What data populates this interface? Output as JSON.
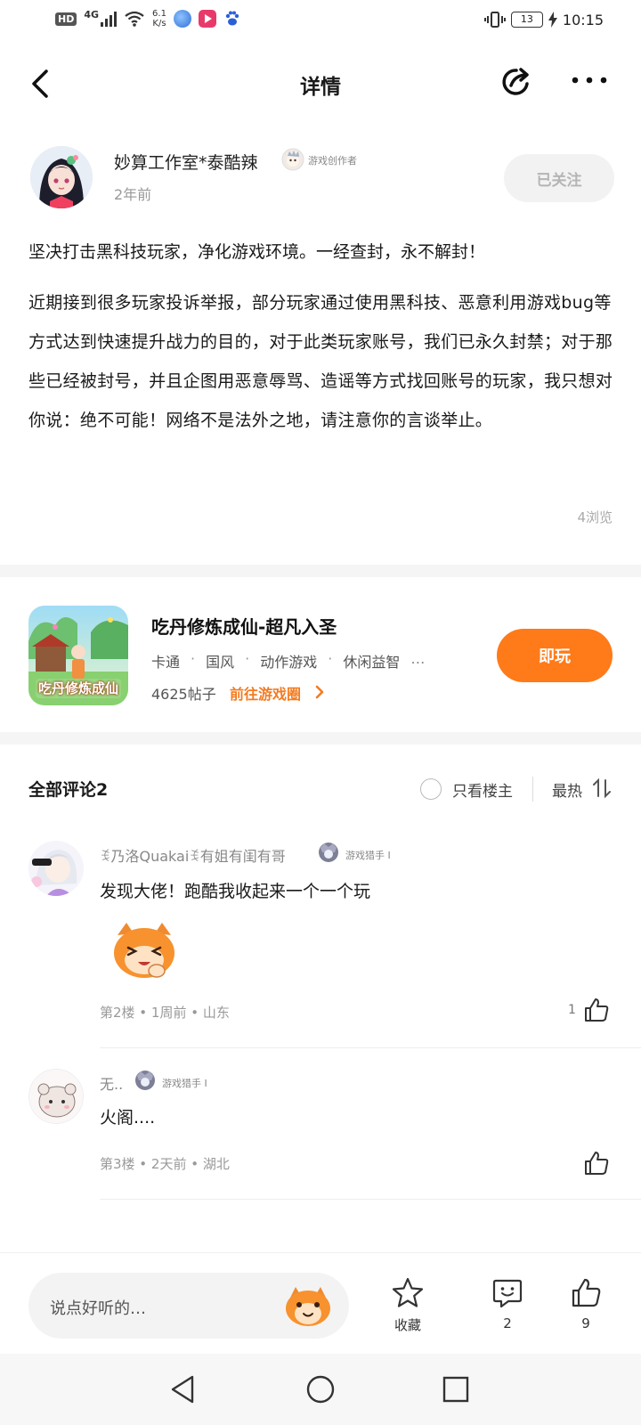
{
  "status_bar": {
    "hd": "HD",
    "network": "4G",
    "speed_value": "6.1",
    "speed_unit": "K/s",
    "battery": "13",
    "time": "10:15"
  },
  "header": {
    "title": "详情"
  },
  "author": {
    "name": "妙算工作室*泰酷辣",
    "badge": "游戏创作者",
    "time": "2年前",
    "follow_label": "已关注"
  },
  "post": {
    "headline": "坚决打击黑科技玩家，净化游戏环境。一经查封，永不解封！",
    "body": "近期接到很多玩家投诉举报，部分玩家通过使用黑科技、恶意利用游戏bug等方式达到快速提升战力的目的，对于此类玩家账号，我们已永久封禁；对于那些已经被封号，并且企图用恶意辱骂、造谣等方式找回账号的玩家，我只想对你说：绝不可能！网络不是法外之地，请注意你的言谈举止。",
    "views": "4浏览"
  },
  "game_card": {
    "title": "吃丹修炼成仙-超凡入圣",
    "icon_caption": "吃丹修炼成仙",
    "tags": [
      "卡通",
      "国风",
      "动作游戏",
      "休闲益智"
    ],
    "tags_more": "…",
    "posts": "4625帖子",
    "goto_label": "前往游戏圈",
    "play_label": "即玩"
  },
  "comments_section": {
    "title": "全部评论2",
    "owner_only_label": "只看楼主",
    "sort_label": "最热"
  },
  "comments": [
    {
      "name": "ꉂ乃洛Quakaiꉂ有姐有闺有哥",
      "badge": "游戏猎手 I",
      "text": "发现大佬！跑酷我收起来一个一个玩",
      "meta": "第2楼 • 1周前 • 山东",
      "likes": "1"
    },
    {
      "name": "无..",
      "badge": "游戏猎手 I",
      "text": "火阁....",
      "meta": "第3楼 • 2天前 • 湖北",
      "likes": ""
    }
  ],
  "bottom_bar": {
    "input_placeholder": "说点好听的…",
    "collect_label": "收藏",
    "comment_count": "2",
    "like_count": "9"
  },
  "colors": {
    "accent": "#ff7a18",
    "link": "#f47b20",
    "muted": "#999999"
  }
}
